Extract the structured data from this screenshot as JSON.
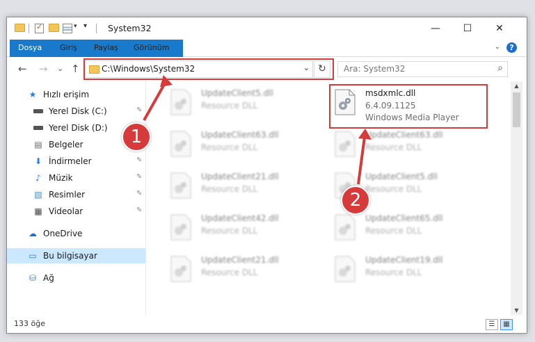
{
  "window": {
    "title": "System32",
    "controls": {
      "minimize": "—",
      "maximize": "☐",
      "close": "✕"
    }
  },
  "ribbon": {
    "tabs": [
      "Dosya",
      "Giriş",
      "Paylaş",
      "Görünüm"
    ],
    "expand_icon": "⌄",
    "help_icon": "?"
  },
  "navigation": {
    "back": "←",
    "forward": "→",
    "recent": "⌄",
    "up": "↑",
    "address": "C:\\Windows\\System32",
    "address_chevron": "⌄",
    "refresh": "↻",
    "search_placeholder": "Ara: System32",
    "search_icon": "⌕"
  },
  "sidebar": {
    "items": [
      {
        "label": "Hızlı erişim",
        "icon": "star-icon",
        "glyph": "★",
        "pinned": false
      },
      {
        "label": "Yerel Disk (C:)",
        "icon": "drive-icon",
        "glyph": "",
        "pinned": true
      },
      {
        "label": "Yerel Disk (D:)",
        "icon": "drive-icon",
        "glyph": "",
        "pinned": true
      },
      {
        "label": "Belgeler",
        "icon": "documents-icon",
        "glyph": "▤",
        "pinned": true
      },
      {
        "label": "İndirmeler",
        "icon": "download-icon",
        "glyph": "⬇",
        "pinned": true
      },
      {
        "label": "Müzik",
        "icon": "music-icon",
        "glyph": "♪",
        "pinned": true
      },
      {
        "label": "Resimler",
        "icon": "pictures-icon",
        "glyph": "▧",
        "pinned": true
      },
      {
        "label": "Videolar",
        "icon": "video-icon",
        "glyph": "▦",
        "pinned": true
      },
      {
        "label": "OneDrive",
        "icon": "cloud-icon",
        "glyph": "☁",
        "pinned": false
      },
      {
        "label": "Bu bilgisayar",
        "icon": "computer-icon",
        "glyph": "▭",
        "pinned": false,
        "selected": true
      },
      {
        "label": "Ağ",
        "icon": "network-icon",
        "glyph": "⛁",
        "pinned": false
      }
    ],
    "pin_glyph": "📌"
  },
  "files": {
    "left_column": [
      {
        "name": "UpdateClient5.dll",
        "type": "Resource DLL"
      },
      {
        "name": "UpdateClient63.dll",
        "type": "Resource DLL"
      },
      {
        "name": "UpdateClient21.dll",
        "type": "Resource DLL"
      },
      {
        "name": "UpdateClient42.dll",
        "type": "Resource DLL"
      },
      {
        "name": "UpdateClient21.dll",
        "type": "Resource DLL"
      }
    ],
    "right_column": [
      {
        "name": "msdxmlc.dll",
        "version": "6.4.09.1125",
        "type": "Windows Media Player"
      },
      {
        "name": "UpdateClient63.dll",
        "type": "Resource DLL"
      },
      {
        "name": "UpdateClient5.dll",
        "type": "Resource DLL"
      },
      {
        "name": "UpdateClient65.dll",
        "type": "Resource DLL"
      },
      {
        "name": "UpdateClient19.dll",
        "type": "Resource DLL"
      }
    ]
  },
  "status": {
    "item_count": "133 öğe"
  },
  "annotations": {
    "badge_1": "1",
    "badge_2": "2",
    "color": "#d63a3a"
  }
}
